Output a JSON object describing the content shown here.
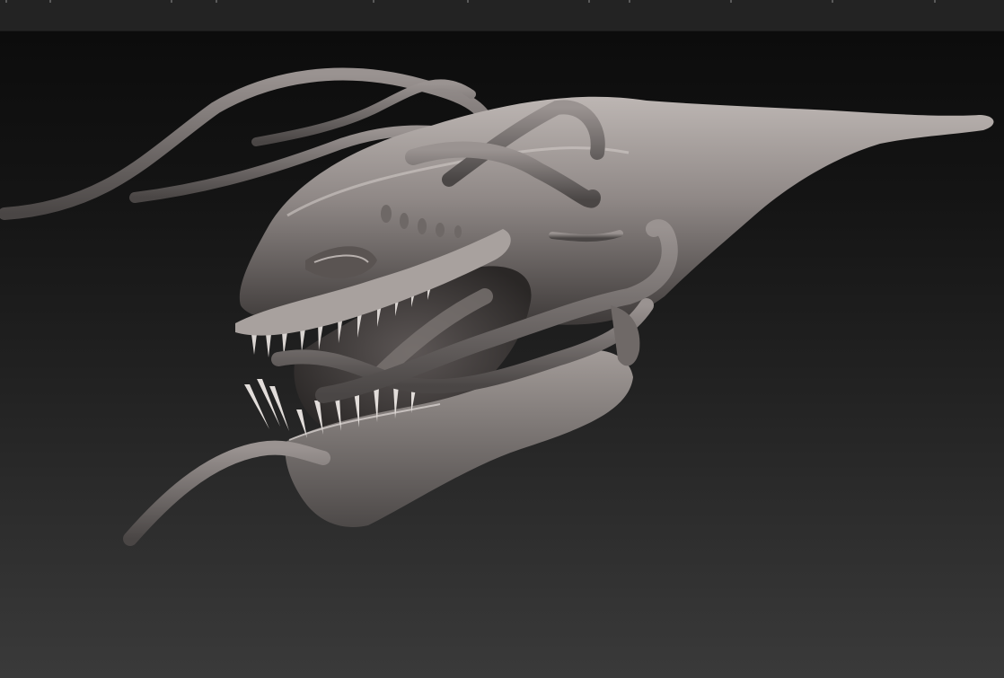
{
  "app": {
    "title": "",
    "background_color": "#1e1e1e"
  },
  "viewport": {
    "subject": "",
    "material_color": "#8a8482",
    "highlight_color": "#c9c3c0",
    "shadow_color": "#3a3736"
  }
}
